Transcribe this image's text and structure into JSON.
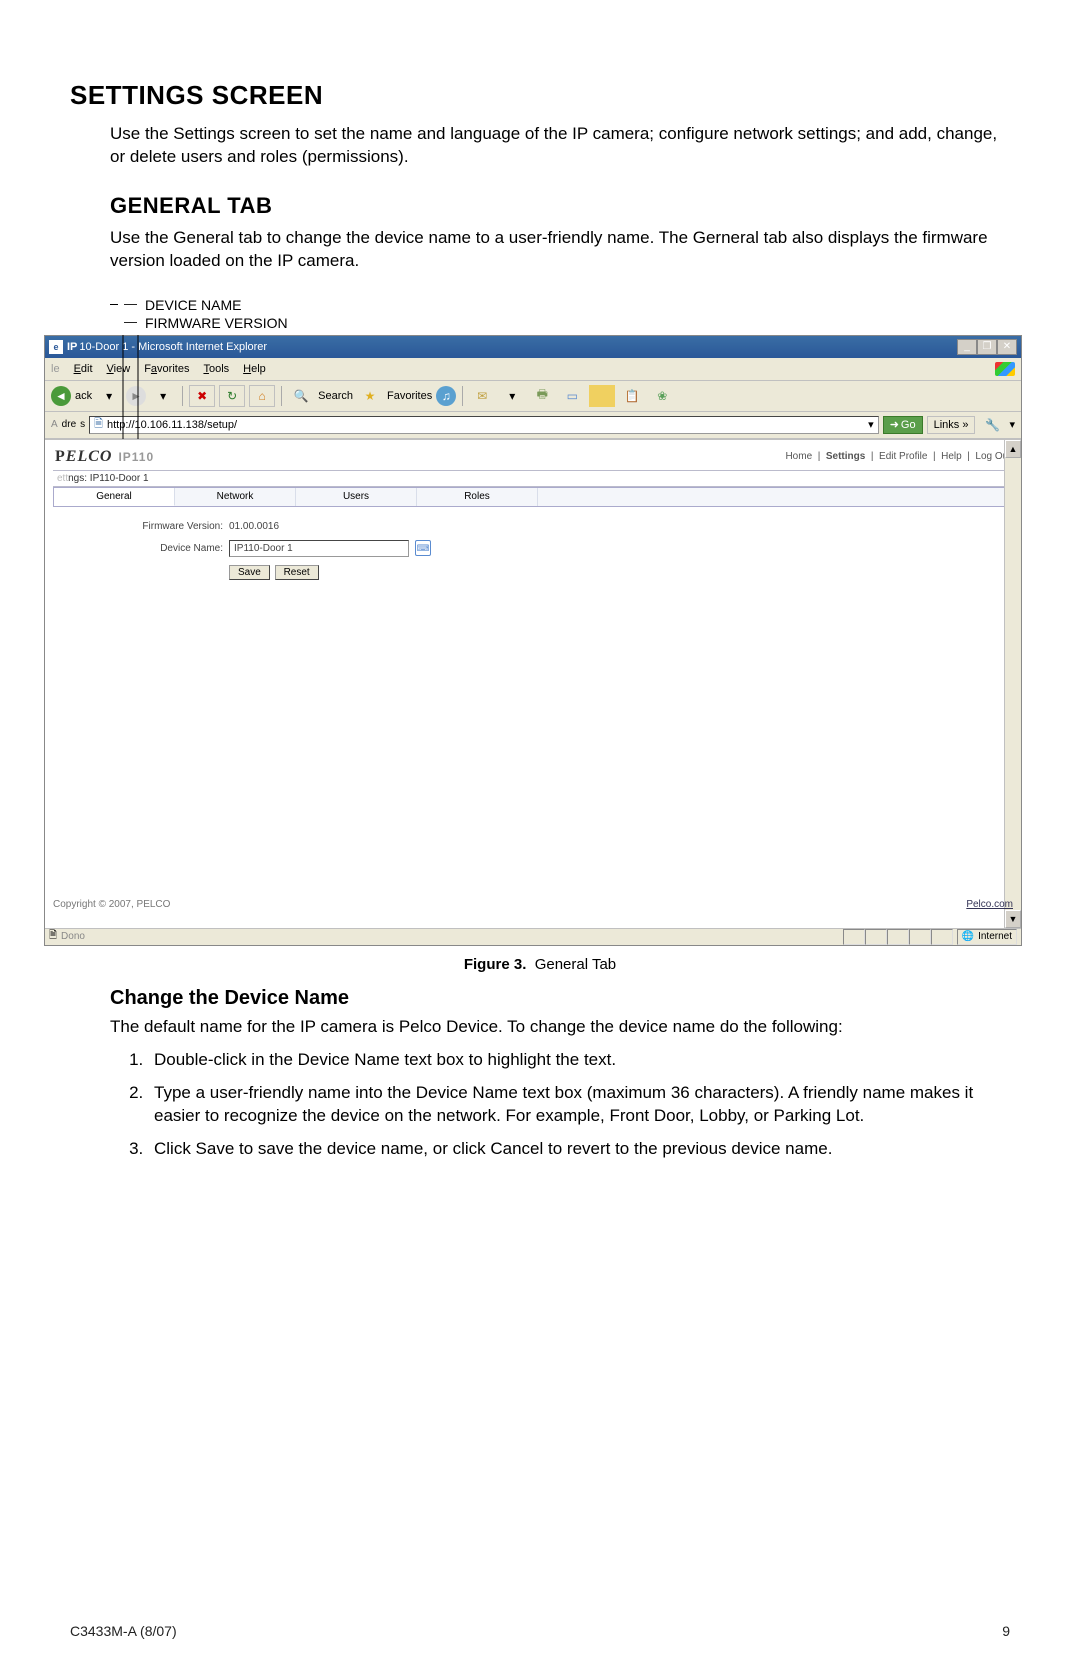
{
  "doc": {
    "h1": "SETTINGS SCREEN",
    "p1": "Use the Settings screen to set the name and language of the IP camera; configure network settings; and add, change, or delete users and roles (permissions).",
    "h2": "GENERAL TAB",
    "p2": "Use the General tab to change the device name to a user-friendly name. The Gerneral tab also displays the firmware version loaded on the IP camera.",
    "callout1": "DEVICE NAME",
    "callout2": "FIRMWARE VERSION",
    "fig_label": "Figure 3.",
    "fig_caption": "General Tab",
    "h3": "Change the Device Name",
    "p3": "The default name for the IP camera is Pelco Device. To change the device name do the following:",
    "steps": [
      "Double-click in the Device Name text box to highlight the text.",
      "Type a user-friendly name into the Device Name text box (maximum 36 characters). A friendly name makes it easier to recognize the device on the network. For example, Front Door, Lobby, or Parking Lot.",
      "Click Save to save the device name, or click Cancel to revert to the previous device name."
    ],
    "footer_left": "C3433M-A (8/07)",
    "footer_page": "9"
  },
  "ie": {
    "title_prefix": "IP",
    "title": "10-Door 1 - Microsoft Internet Explorer",
    "menus": [
      "File",
      "Edit",
      "View",
      "Favorites",
      "Tools",
      "Help"
    ],
    "tb": {
      "back": "ack",
      "search": "Search",
      "favorites": "Favorites"
    },
    "addr_label": "Address",
    "addr_short": "dre",
    "url": "http://10.106.11.138/setup/",
    "go": "Go",
    "links": "Links"
  },
  "pelco": {
    "logo": "PELCO",
    "model": "IP110",
    "nav": {
      "home": "Home",
      "settings": "Settings",
      "edit_profile": "Edit Profile",
      "help": "Help",
      "logout": "Log Out"
    },
    "settings_label_prefix": "ett",
    "settings_label": "ngs: IP110-Door 1",
    "tabs": [
      "General",
      "Network",
      "Users",
      "Roles"
    ],
    "firmware_label": "Firmware Version:",
    "firmware_value": "01.00.0016",
    "devname_label": "Device Name:",
    "devname_value": "IP110-Door 1",
    "save": "Save",
    "reset": "Reset",
    "copyright": "Copyright © 2007, PELCO",
    "pelco_link": "Pelco.com"
  },
  "status": {
    "done_icon": "🗎",
    "done": "Dono",
    "zone": "Internet"
  }
}
